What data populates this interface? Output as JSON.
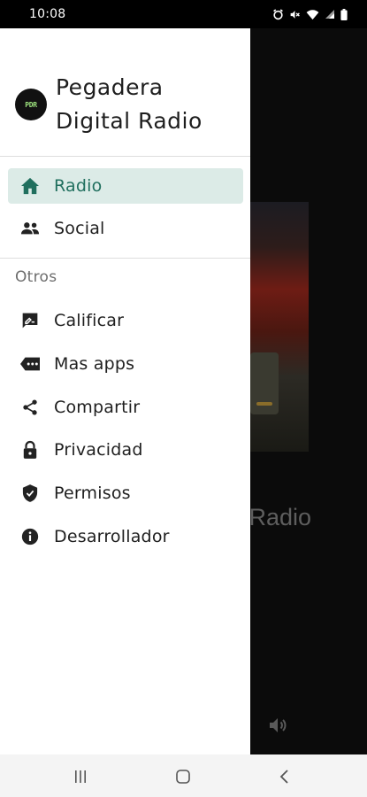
{
  "status_bar": {
    "time": "10:08",
    "icons": [
      "alarm-icon",
      "mute-icon",
      "wifi-icon",
      "signal-icon",
      "battery-icon"
    ]
  },
  "background": {
    "title_fragment": "l Radio"
  },
  "drawer": {
    "app_title": "Pegadera Digital Radio",
    "logo_text": "PDR",
    "primary_items": [
      {
        "label": "Radio",
        "icon": "home-icon",
        "active": true
      },
      {
        "label": "Social",
        "icon": "people-icon",
        "active": false
      }
    ],
    "section_title": "Otros",
    "other_items": [
      {
        "label": "Calificar",
        "icon": "rate-review-icon"
      },
      {
        "label": "Mas apps",
        "icon": "more-apps-icon"
      },
      {
        "label": "Compartir",
        "icon": "share-icon"
      },
      {
        "label": "Privacidad",
        "icon": "lock-icon"
      },
      {
        "label": "Permisos",
        "icon": "shield-check-icon"
      },
      {
        "label": "Desarrollador",
        "icon": "info-icon"
      }
    ]
  },
  "colors": {
    "accent": "#206f5e",
    "active_background": "#dcebe7",
    "drawer_background": "#ffffff",
    "scrim": "#000000"
  }
}
